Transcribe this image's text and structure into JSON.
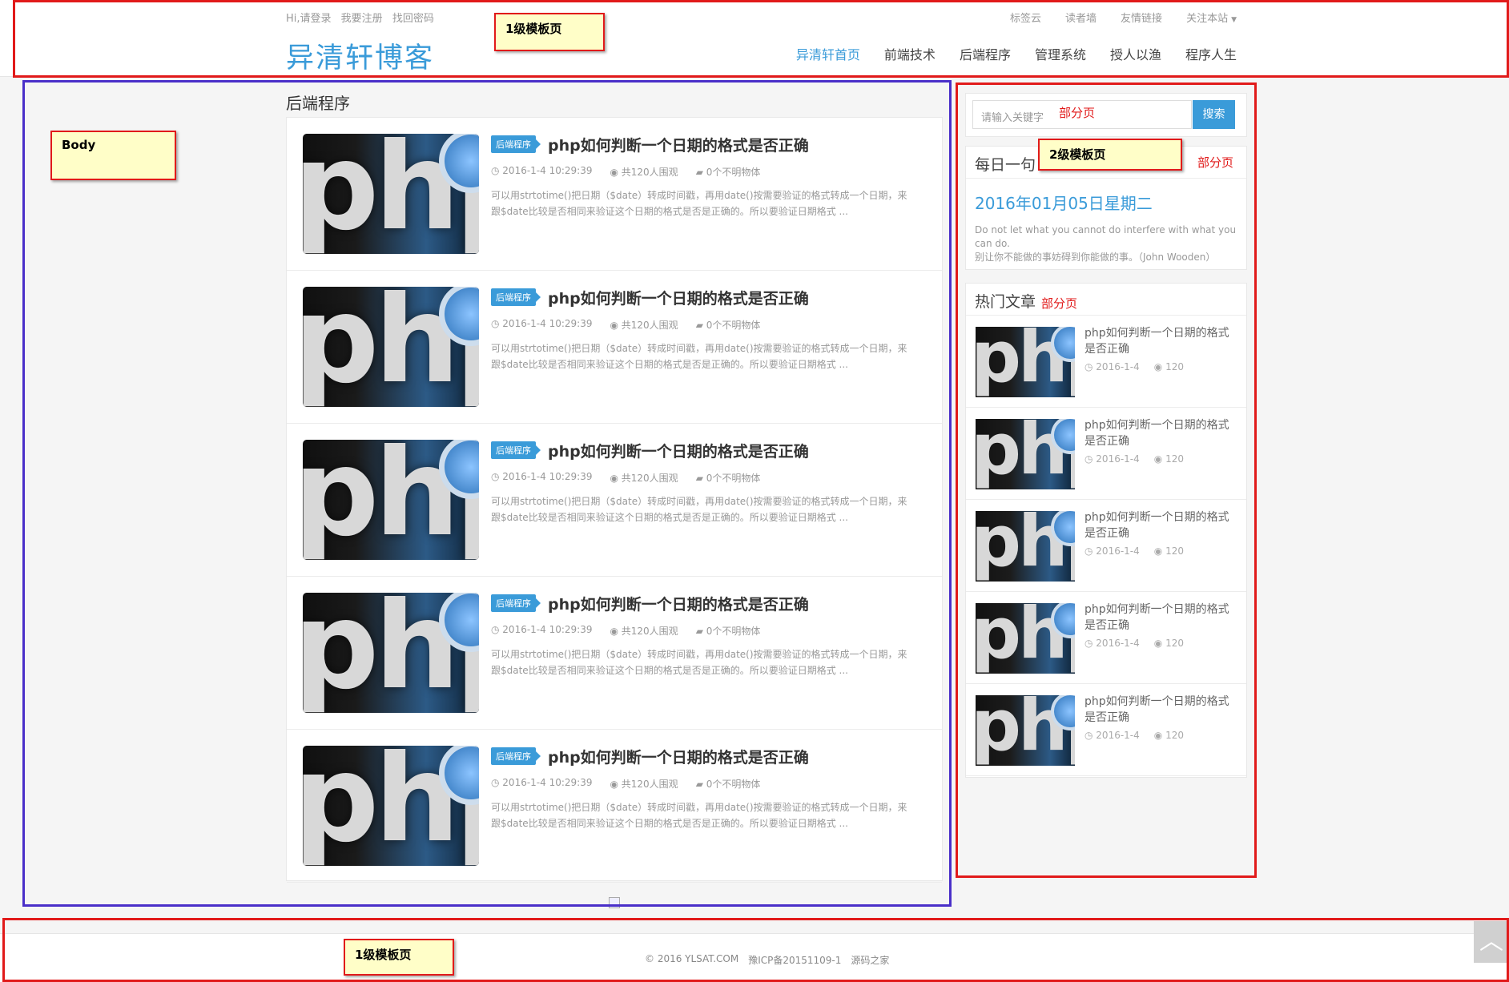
{
  "topbar": {
    "login": "Hi,请登录",
    "register": "我要注册",
    "forgot": "找回密码",
    "right_links": [
      "标签云",
      "读者墙",
      "友情链接"
    ],
    "follow": "关注本站"
  },
  "brand": "异清轩博客",
  "nav": [
    "异清轩首页",
    "前端技术",
    "后端程序",
    "管理系统",
    "授人以渔",
    "程序人生"
  ],
  "section_title": "后端程序",
  "articles": [
    {
      "tag": "后端程序",
      "title": "php如何判断一个日期的格式是否正确",
      "date": "2016-1-4 10:29:39",
      "views": "共120人围观",
      "comments": "0个不明物体",
      "desc": "可以用strtotime()把日期（$date）转成时间戳，再用date()按需要验证的格式转成一个日期，来跟$date比较是否相同来验证这个日期的格式是否是正确的。所以要验证日期格式 ..."
    },
    {
      "tag": "后端程序",
      "title": "php如何判断一个日期的格式是否正确",
      "date": "2016-1-4 10:29:39",
      "views": "共120人围观",
      "comments": "0个不明物体",
      "desc": "可以用strtotime()把日期（$date）转成时间戳，再用date()按需要验证的格式转成一个日期，来跟$date比较是否相同来验证这个日期的格式是否是正确的。所以要验证日期格式 ..."
    },
    {
      "tag": "后端程序",
      "title": "php如何判断一个日期的格式是否正确",
      "date": "2016-1-4 10:29:39",
      "views": "共120人围观",
      "comments": "0个不明物体",
      "desc": "可以用strtotime()把日期（$date）转成时间戳，再用date()按需要验证的格式转成一个日期，来跟$date比较是否相同来验证这个日期的格式是否是正确的。所以要验证日期格式 ..."
    },
    {
      "tag": "后端程序",
      "title": "php如何判断一个日期的格式是否正确",
      "date": "2016-1-4 10:29:39",
      "views": "共120人围观",
      "comments": "0个不明物体",
      "desc": "可以用strtotime()把日期（$date）转成时间戳，再用date()按需要验证的格式转成一个日期，来跟$date比较是否相同来验证这个日期的格式是否是正确的。所以要验证日期格式 ..."
    },
    {
      "tag": "后端程序",
      "title": "php如何判断一个日期的格式是否正确",
      "date": "2016-1-4 10:29:39",
      "views": "共120人围观",
      "comments": "0个不明物体",
      "desc": "可以用strtotime()把日期（$date）转成时间戳，再用date()按需要验证的格式转成一个日期，来跟$date比较是否相同来验证这个日期的格式是否是正确的。所以要验证日期格式 ..."
    }
  ],
  "thumb_text": "php",
  "search": {
    "placeholder": "请输入关键字",
    "button": "搜索"
  },
  "daily": {
    "heading": "每日一句",
    "date": "2016年01月05日星期二",
    "quote_en": "Do not let what you cannot do interfere with what you can do.",
    "quote_cn": "别让你不能做的事妨碍到你能做的事。（John Wooden）"
  },
  "hot": {
    "heading": "热门文章",
    "items": [
      {
        "title": "php如何判断一个日期的格式是否正确",
        "date": "2016-1-4",
        "views": "120"
      },
      {
        "title": "php如何判断一个日期的格式是否正确",
        "date": "2016-1-4",
        "views": "120"
      },
      {
        "title": "php如何判断一个日期的格式是否正确",
        "date": "2016-1-4",
        "views": "120"
      },
      {
        "title": "php如何判断一个日期的格式是否正确",
        "date": "2016-1-4",
        "views": "120"
      },
      {
        "title": "php如何判断一个日期的格式是否正确",
        "date": "2016-1-4",
        "views": "120"
      }
    ]
  },
  "footer": {
    "copyright": "© 2016 YLSAT.COM",
    "icp": "豫ICP备20151109-1",
    "source": "源码之家"
  },
  "annotations": {
    "level1_header": "1级模板页",
    "body": "Body",
    "level2": "2级模板页",
    "partial_search": "部分页",
    "partial_daily": "部分页",
    "partial_hot": "部分页",
    "level1_footer": "1级模板页"
  },
  "colors": {
    "accent": "#3a9bd9",
    "annotation_red": "#e11a1a",
    "annotation_blue": "#4a2fc9",
    "note_bg": "#fffec8"
  }
}
